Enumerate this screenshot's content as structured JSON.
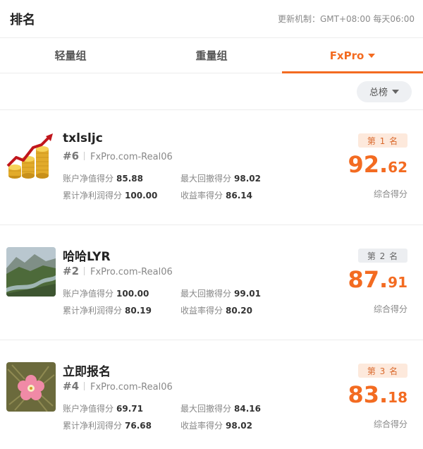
{
  "header": {
    "title": "排名",
    "update_info": "更新机制：GMT+08:00 每天06:00"
  },
  "tabs": [
    {
      "label": "轻量组",
      "active": false
    },
    {
      "label": "重量组",
      "active": false
    },
    {
      "label": "FxPro",
      "active": true
    }
  ],
  "filter": {
    "label": "总榜"
  },
  "colors": {
    "accent": "#f36b21",
    "text": "#222222",
    "muted": "#888888"
  },
  "rankings": [
    {
      "name": "txlsljc",
      "rank": "#6",
      "account": "FxPro.com-Real06",
      "place": "第 1 名",
      "score_int": "92",
      "score_dot": ".",
      "score_dec": "62",
      "score_label": "综合得分",
      "stats": {
        "equity_label": "账户净值得分",
        "equity": "85.88",
        "drawdown_label": "最大回撤得分",
        "drawdown": "98.02",
        "profit_label": "累计净利润得分",
        "profit": "100.00",
        "return_label": "收益率得分",
        "return": "86.14"
      },
      "avatar": "gold-coins-chart-icon"
    },
    {
      "name": "哈哈LYR",
      "rank": "#2",
      "account": "FxPro.com-Real06",
      "place": "第 2 名",
      "score_int": "87",
      "score_dot": ".",
      "score_dec": "91",
      "score_label": "综合得分",
      "stats": {
        "equity_label": "账户净值得分",
        "equity": "100.00",
        "drawdown_label": "最大回撤得分",
        "drawdown": "99.01",
        "profit_label": "累计净利润得分",
        "profit": "80.19",
        "return_label": "收益率得分",
        "return": "80.20"
      },
      "avatar": "landscape-photo-icon"
    },
    {
      "name": "立即报名",
      "rank": "#4",
      "account": "FxPro.com-Real06",
      "place": "第 3 名",
      "score_int": "83",
      "score_dot": ".",
      "score_dec": "18",
      "score_label": "综合得分",
      "stats": {
        "equity_label": "账户净值得分",
        "equity": "69.71",
        "drawdown_label": "最大回撤得分",
        "drawdown": "84.16",
        "profit_label": "累计净利润得分",
        "profit": "76.68",
        "return_label": "收益率得分",
        "return": "98.02"
      },
      "avatar": "pink-flower-photo-icon"
    }
  ]
}
